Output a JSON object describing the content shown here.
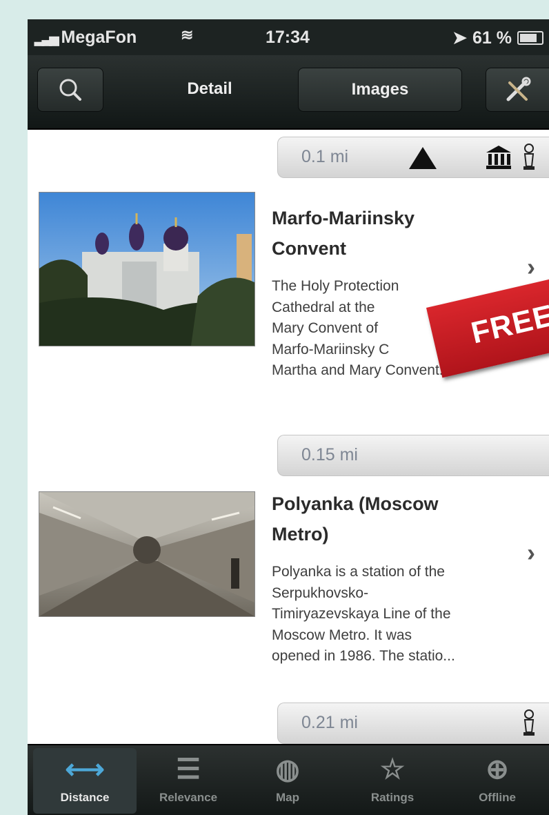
{
  "status_bar": {
    "carrier": "MegaFon",
    "time": "17:34",
    "battery": "61 %"
  },
  "nav": {
    "tabs": [
      {
        "label": "Detail",
        "selected": true
      },
      {
        "label": "Images",
        "selected": false
      }
    ],
    "search_icon": "magnifier-icon",
    "tools_icon": "tools-icon"
  },
  "list": {
    "top_partial_distance": "0.1 mi",
    "items": [
      {
        "title_line1": "Marfo-Mariinsky",
        "title_line2": "Convent",
        "description_lines": [
          "The Holy Protection",
          "Cathedral at the",
          "Mary Convent of",
          "Marfo-Mariinsky C",
          "Martha and Mary Convent..."
        ],
        "distance": "0.15 mi",
        "badge": "FREE"
      },
      {
        "title_line1": "Polyanka (Moscow",
        "title_line2": "Metro)",
        "description_lines": [
          "Polyanka is a station of the",
          "Serpukhovsko-",
          "Timiryazevskaya Line of the",
          "Moscow Metro. It was",
          "opened in 1986. The statio..."
        ],
        "distance": "0.21 mi"
      }
    ]
  },
  "tab_bar": {
    "tabs": [
      {
        "label": "Distance",
        "icon": "arrows-horizontal-icon",
        "active": true
      },
      {
        "label": "Relevance",
        "icon": "list-icon",
        "active": false
      },
      {
        "label": "Map",
        "icon": "globe-icon",
        "active": false
      },
      {
        "label": "Ratings",
        "icon": "star-icon",
        "active": false
      },
      {
        "label": "Offline",
        "icon": "download-icon",
        "active": false
      }
    ]
  },
  "colors": {
    "background": "#d8ece9",
    "bar_dark": "#1d2322",
    "ribbon_red": "#c91d23",
    "active_icon": "#4da8d8"
  }
}
